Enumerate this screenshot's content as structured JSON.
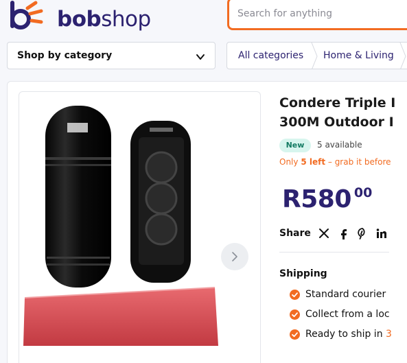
{
  "header": {
    "logo_text_bold": "bob",
    "logo_text_light": "shop",
    "search_placeholder": "Search for anything"
  },
  "nav": {
    "category_button_label": "Shop by category",
    "breadcrumbs": [
      "All categories",
      "Home & Living"
    ]
  },
  "product": {
    "title_line1": "Condere Triple I",
    "title_line2": "300M Outdoor I",
    "condition_badge": "New",
    "availability": "5 available",
    "stock_prefix": "Only ",
    "stock_count": "5 left",
    "stock_suffix": " – grab it before",
    "price_main": "R580",
    "price_cents": "00"
  },
  "share": {
    "label": "Share",
    "icons": [
      "x-icon",
      "facebook-icon",
      "pinterest-icon",
      "linkedin-icon"
    ]
  },
  "shipping": {
    "title": "Shipping",
    "items": [
      "Standard courier",
      "Collect from a loc",
      "Ready to ship in "
    ],
    "items_highlight": [
      "",
      "",
      "3"
    ]
  },
  "colors": {
    "brand": "#2c2270",
    "accent": "#f26b21",
    "new_badge_bg": "#d7f5ee",
    "new_badge_text": "#127a62"
  }
}
